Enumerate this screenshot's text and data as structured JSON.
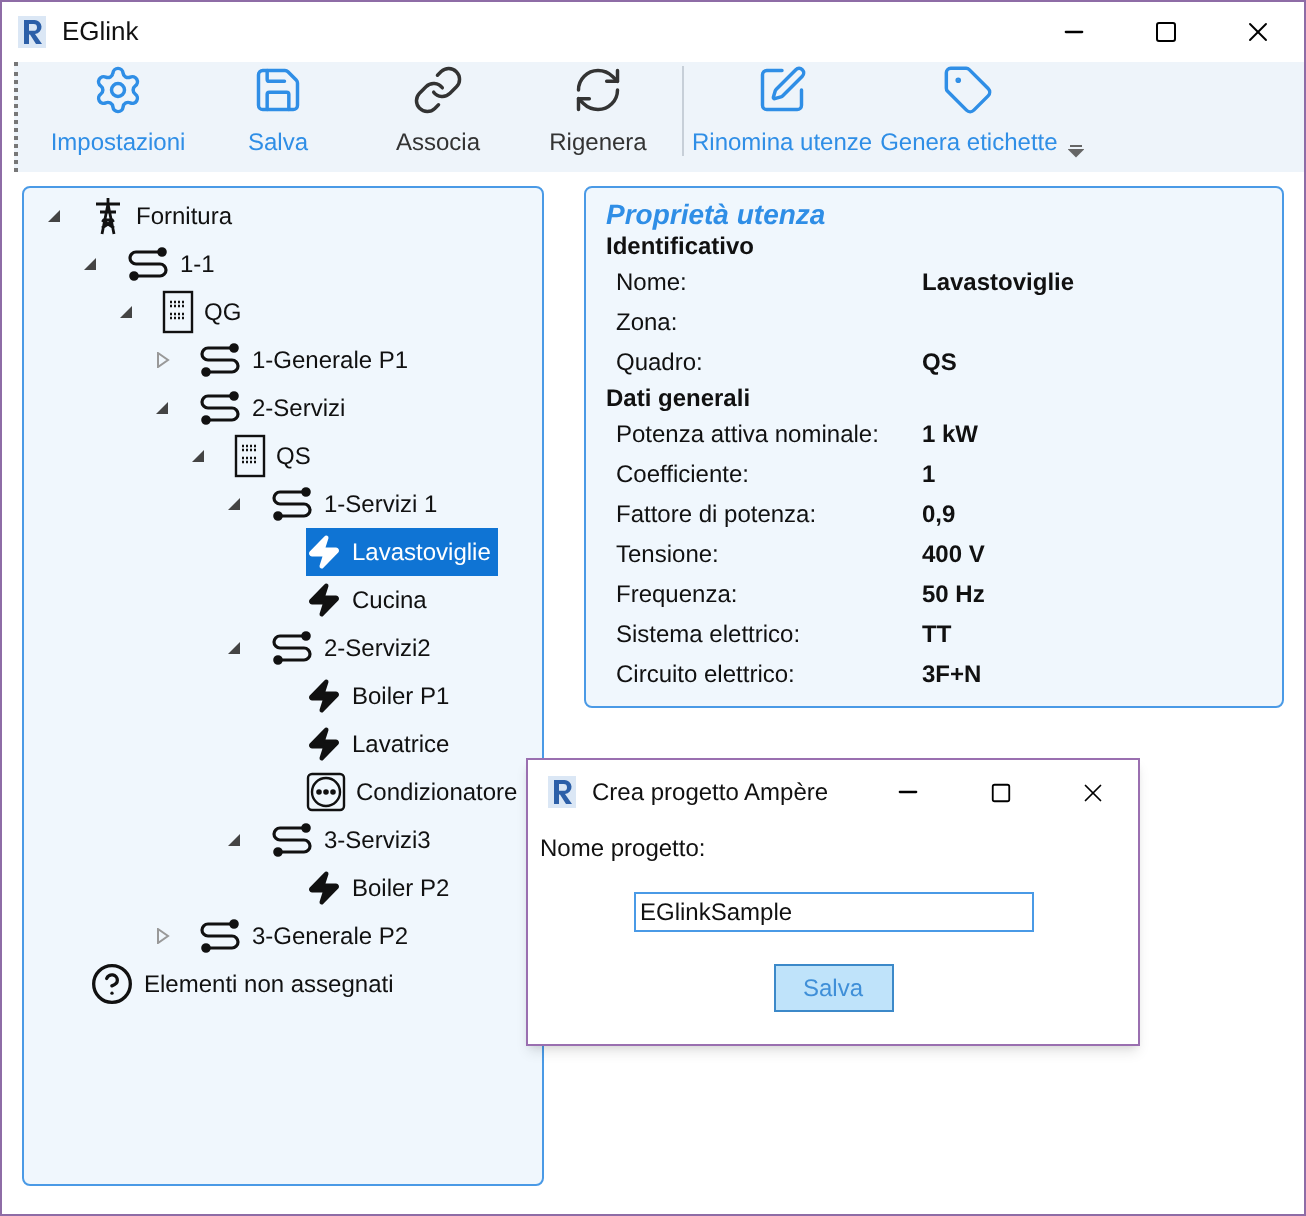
{
  "window": {
    "title": "EGlink"
  },
  "toolbar": [
    {
      "label": "Impostazioni",
      "kind": "settings",
      "active": true
    },
    {
      "label": "Salva",
      "kind": "save",
      "active": true
    },
    {
      "label": "Associa",
      "kind": "link",
      "active": false
    },
    {
      "label": "Rigenera",
      "kind": "refresh",
      "active": false
    },
    {
      "label": "Rinomina utenze",
      "kind": "rename",
      "active": true,
      "separator": true
    },
    {
      "label": "Genera etichette",
      "kind": "tag",
      "active": true
    }
  ],
  "tree": [
    {
      "label": "Fornitura",
      "kind": "supply",
      "expanded": true,
      "selected": false,
      "children": [
        {
          "label": "1-1",
          "kind": "line",
          "expanded": true,
          "selected": false,
          "children": [
            {
              "label": "QG",
              "kind": "panel",
              "expanded": true,
              "selected": false,
              "children": [
                {
                  "label": "1-Generale P1",
                  "kind": "line",
                  "expanded": false,
                  "selected": false
                },
                {
                  "label": "2-Servizi",
                  "kind": "line",
                  "expanded": true,
                  "selected": false,
                  "children": [
                    {
                      "label": "QS",
                      "kind": "panel",
                      "expanded": true,
                      "selected": false,
                      "children": [
                        {
                          "label": "1-Servizi 1",
                          "kind": "line",
                          "expanded": true,
                          "selected": false,
                          "children": [
                            {
                              "label": "Lavastoviglie",
                              "kind": "load",
                              "selected": true
                            },
                            {
                              "label": "Cucina",
                              "kind": "load",
                              "selected": false
                            }
                          ]
                        },
                        {
                          "label": "2-Servizi2",
                          "kind": "line",
                          "expanded": true,
                          "selected": false,
                          "children": [
                            {
                              "label": "Boiler P1",
                              "kind": "load",
                              "selected": false
                            },
                            {
                              "label": "Lavatrice",
                              "kind": "load",
                              "selected": false
                            },
                            {
                              "label": "Condizionatore",
                              "kind": "socket",
                              "selected": false
                            }
                          ]
                        },
                        {
                          "label": "3-Servizi3",
                          "kind": "line",
                          "expanded": true,
                          "selected": false,
                          "children": [
                            {
                              "label": "Boiler P2",
                              "kind": "load",
                              "selected": false
                            }
                          ]
                        }
                      ]
                    }
                  ]
                },
                {
                  "label": "3-Generale P2",
                  "kind": "line",
                  "expanded": false,
                  "selected": false
                }
              ]
            }
          ]
        }
      ]
    },
    {
      "label": "Elementi non assegnati",
      "kind": "unassigned",
      "selected": false
    }
  ],
  "properties": {
    "title": "Proprietà utenza",
    "sections": [
      {
        "heading": "Identificativo",
        "rows": [
          {
            "label": "Nome:",
            "value": "Lavastoviglie"
          },
          {
            "label": "Zona:"
          },
          {
            "label": "Quadro:",
            "value": "QS"
          }
        ]
      },
      {
        "heading": "Dati generali",
        "rows": [
          {
            "label": "Potenza attiva nominale:",
            "value": "1 kW"
          },
          {
            "label": "Coefficiente:",
            "value": "1"
          },
          {
            "label": "Fattore di potenza:",
            "value": "0,9"
          },
          {
            "label": "Tensione:",
            "value": "400 V"
          },
          {
            "label": "Frequenza:",
            "value": "50 Hz"
          },
          {
            "label": "Sistema elettrico:",
            "value": "TT"
          },
          {
            "label": "Circuito elettrico:",
            "value": "3F+N"
          }
        ]
      }
    ]
  },
  "dialog": {
    "title": "Crea progetto Ampère",
    "field_label": "Nome progetto:",
    "field_value": "EGlinkSample",
    "button": "Salva"
  }
}
